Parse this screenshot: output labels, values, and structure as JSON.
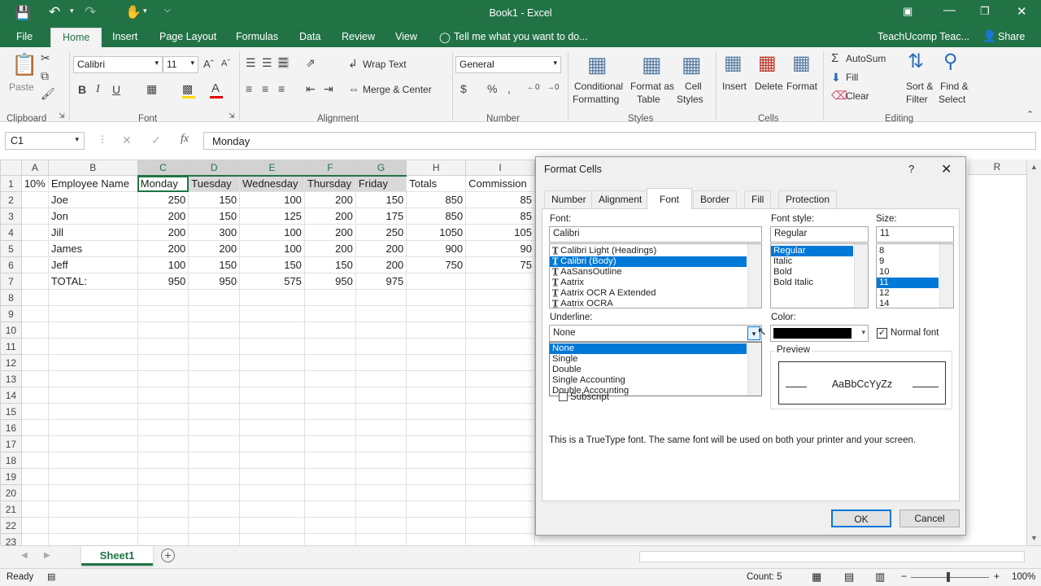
{
  "title": "Book1 - Excel",
  "account": "TeachUcomp Teac...",
  "share_label": "Share",
  "tell_me": "Tell me what you want to do...",
  "menu": [
    "File",
    "Home",
    "Insert",
    "Page Layout",
    "Formulas",
    "Data",
    "Review",
    "View"
  ],
  "ribbon": {
    "paste": "Paste",
    "font_name": "Calibri",
    "font_size": "11",
    "wrap_text": "Wrap Text",
    "merge_center": "Merge & Center",
    "number_format": "General",
    "cond_format": [
      "Conditional",
      "Formatting"
    ],
    "format_table": [
      "Format as",
      "Table"
    ],
    "cell_styles": [
      "Cell",
      "Styles"
    ],
    "insert": "Insert",
    "delete": "Delete",
    "format": "Format",
    "autosum": "AutoSum",
    "fill": "Fill",
    "clear": "Clear",
    "sort_filter": [
      "Sort &",
      "Filter"
    ],
    "find_select": [
      "Find &",
      "Select"
    ],
    "groups": [
      "Clipboard",
      "Font",
      "Alignment",
      "Number",
      "Styles",
      "Cells",
      "Editing"
    ]
  },
  "formula_bar": {
    "name_box": "C1",
    "fx": "fx",
    "value": "Monday"
  },
  "grid": {
    "columns": [
      "A",
      "B",
      "C",
      "D",
      "E",
      "F",
      "G",
      "H",
      "I"
    ],
    "rows": [
      [
        "10%",
        "Employee Name",
        "Monday",
        "Tuesday",
        "Wednesday",
        "Thursday",
        "Friday",
        "Totals",
        "Commission"
      ],
      [
        "",
        "Joe",
        "250",
        "150",
        "100",
        "200",
        "150",
        "850",
        "85"
      ],
      [
        "",
        "Jon",
        "200",
        "150",
        "125",
        "200",
        "175",
        "850",
        "85"
      ],
      [
        "",
        "Jill",
        "200",
        "300",
        "100",
        "200",
        "250",
        "1050",
        "105"
      ],
      [
        "",
        "James",
        "200",
        "200",
        "100",
        "200",
        "200",
        "900",
        "90"
      ],
      [
        "",
        "Jeff",
        "100",
        "150",
        "150",
        "150",
        "200",
        "750",
        "75"
      ],
      [
        "",
        "TOTAL:",
        "950",
        "950",
        "575",
        "950",
        "975",
        "",
        ""
      ],
      [
        "",
        "",
        "",
        "",
        "",
        "",
        "",
        "",
        ""
      ],
      [
        "",
        "",
        "",
        "",
        "",
        "",
        "",
        "",
        ""
      ],
      [
        "",
        "",
        "",
        "",
        "",
        "",
        "",
        "",
        ""
      ],
      [
        "",
        "",
        "",
        "",
        "",
        "",
        "",
        "",
        ""
      ],
      [
        "",
        "",
        "",
        "",
        "",
        "",
        "",
        "",
        ""
      ],
      [
        "",
        "",
        "",
        "",
        "",
        "",
        "",
        "",
        ""
      ],
      [
        "",
        "",
        "",
        "",
        "",
        "",
        "",
        "",
        ""
      ],
      [
        "",
        "",
        "",
        "",
        "",
        "",
        "",
        "",
        ""
      ],
      [
        "",
        "",
        "",
        "",
        "",
        "",
        "",
        "",
        ""
      ],
      [
        "",
        "",
        "",
        "",
        "",
        "",
        "",
        "",
        ""
      ],
      [
        "",
        "",
        "",
        "",
        "",
        "",
        "",
        "",
        ""
      ],
      [
        "",
        "",
        "",
        "",
        "",
        "",
        "",
        "",
        ""
      ],
      [
        "",
        "",
        "",
        "",
        "",
        "",
        "",
        "",
        ""
      ],
      [
        "",
        "",
        "",
        "",
        "",
        "",
        "",
        "",
        ""
      ],
      [
        "",
        "",
        "",
        "",
        "",
        "",
        "",
        "",
        ""
      ],
      [
        "",
        "",
        "",
        "",
        "",
        "",
        "",
        "",
        ""
      ]
    ],
    "extra_col": "R"
  },
  "dialog": {
    "title": "Format Cells",
    "help": "?",
    "tabs": [
      "Number",
      "Alignment",
      "Font",
      "Border",
      "Fill",
      "Protection"
    ],
    "font_label": "Font:",
    "font_value": "Calibri",
    "fonts": [
      "Calibri Light (Headings)",
      "Calibri (Body)",
      "AaSansOutline",
      "Aatrix",
      "Aatrix OCR A Extended",
      "Aatrix OCRA"
    ],
    "style_label": "Font style:",
    "style_value": "Regular",
    "styles": [
      "Regular",
      "Italic",
      "Bold",
      "Bold Italic"
    ],
    "size_label": "Size:",
    "size_value": "11",
    "sizes": [
      "8",
      "9",
      "10",
      "11",
      "12",
      "14"
    ],
    "underline_label": "Underline:",
    "underline_value": "None",
    "underline_options": [
      "None",
      "Single",
      "Double",
      "Single Accounting",
      "Double Accounting"
    ],
    "color_label": "Color:",
    "normal_font": "Normal font",
    "subscript": "Subscript",
    "preview_label": "Preview",
    "preview_text": "AaBbCcYyZz",
    "info": "This is a TrueType font.  The same font will be used on both your printer and your screen.",
    "ok": "OK",
    "cancel": "Cancel"
  },
  "sheet_tab": "Sheet1",
  "status": {
    "ready": "Ready",
    "count": "Count: 5",
    "zoom": "100%"
  },
  "colors": {
    "excel_green": "#217346",
    "select_blue": "#0078d7"
  }
}
